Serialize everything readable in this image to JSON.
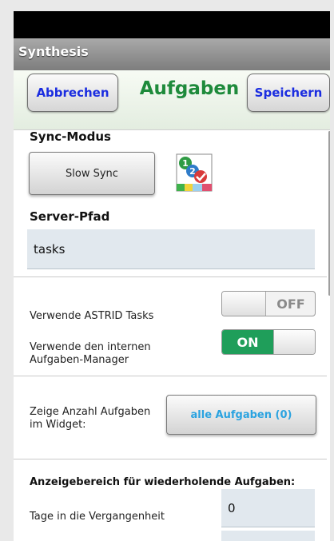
{
  "app_title": "Synthesis",
  "header": {
    "cancel_label": "Abbrechen",
    "title": "Aufgaben",
    "save_label": "Speichern"
  },
  "sync": {
    "label": "Sync-Modus",
    "mode_value": "Slow Sync",
    "icon": "tasks-app-icon"
  },
  "server": {
    "label": "Server-Pfad",
    "value": "tasks"
  },
  "astrid": {
    "label": "Verwende ASTRID Tasks",
    "state": "OFF"
  },
  "internal": {
    "label_line1": "Verwende den internen",
    "label_line2": "Aufgaben-Manager",
    "state": "ON"
  },
  "widget": {
    "label_line1": "Zeige Anzahl Aufgaben",
    "label_line2": "im Widget:",
    "value": "alle Aufgaben  (0)"
  },
  "recurring": {
    "heading": "Anzeigebereich für wiederholende Aufgaben:",
    "past_days_label": "Tage in die Vergangenheit",
    "past_days_value": "0"
  },
  "colors": {
    "accent_green": "#1e8a3b",
    "button_blue": "#1b2de0",
    "toggle_on": "#1f9e5a",
    "widget_value_blue": "#2ba3e0"
  }
}
